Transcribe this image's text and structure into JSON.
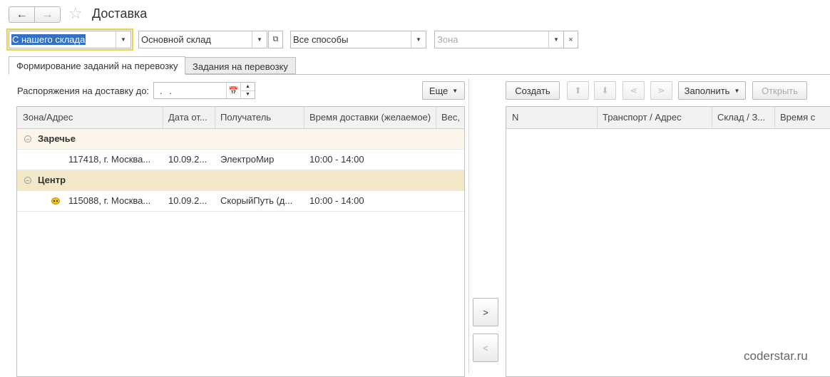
{
  "header": {
    "back_icon": "arrow-left-icon",
    "forward_icon": "arrow-right-icon",
    "favorite_icon": "star-icon",
    "title": "Доставка"
  },
  "filters": {
    "source": "С нашего склада",
    "warehouse": "Основной склад",
    "method": "Все способы",
    "zone_placeholder": "Зона"
  },
  "tabs": [
    {
      "label": "Формирование заданий на перевозку",
      "active": true
    },
    {
      "label": "Задания на перевозку",
      "active": false
    }
  ],
  "left": {
    "date_label": "Распоряжения на доставку до:",
    "date_value": ". .",
    "more_button": "Еще",
    "columns": [
      "Зона/Адрес",
      "Дата от...",
      "Получатель",
      "Время доставки (желаемое)",
      "Вес,"
    ],
    "groups": [
      {
        "name": "Заречье",
        "rows": [
          {
            "address": "117418, г. Москва...",
            "date": "10.09.2...",
            "recipient": "ЭлектроМир",
            "time": "10:00 - 14:00",
            "has_taxi_icon": false
          }
        ]
      },
      {
        "name": "Центр",
        "rows": [
          {
            "address": "115088, г. Москва...",
            "date": "10.09.2...",
            "recipient": "СкорыйПуть (д...",
            "time": "10:00 - 14:00",
            "has_taxi_icon": true
          }
        ]
      }
    ]
  },
  "middle": {
    "move_right": ">",
    "move_left": "<"
  },
  "right": {
    "create_button": "Создать",
    "fill_button": "Заполнить",
    "open_button": "Открыть",
    "columns": [
      "N",
      "Транспорт / Адрес",
      "Склад / З...",
      "Время с"
    ]
  },
  "watermark": "coderstar.ru"
}
